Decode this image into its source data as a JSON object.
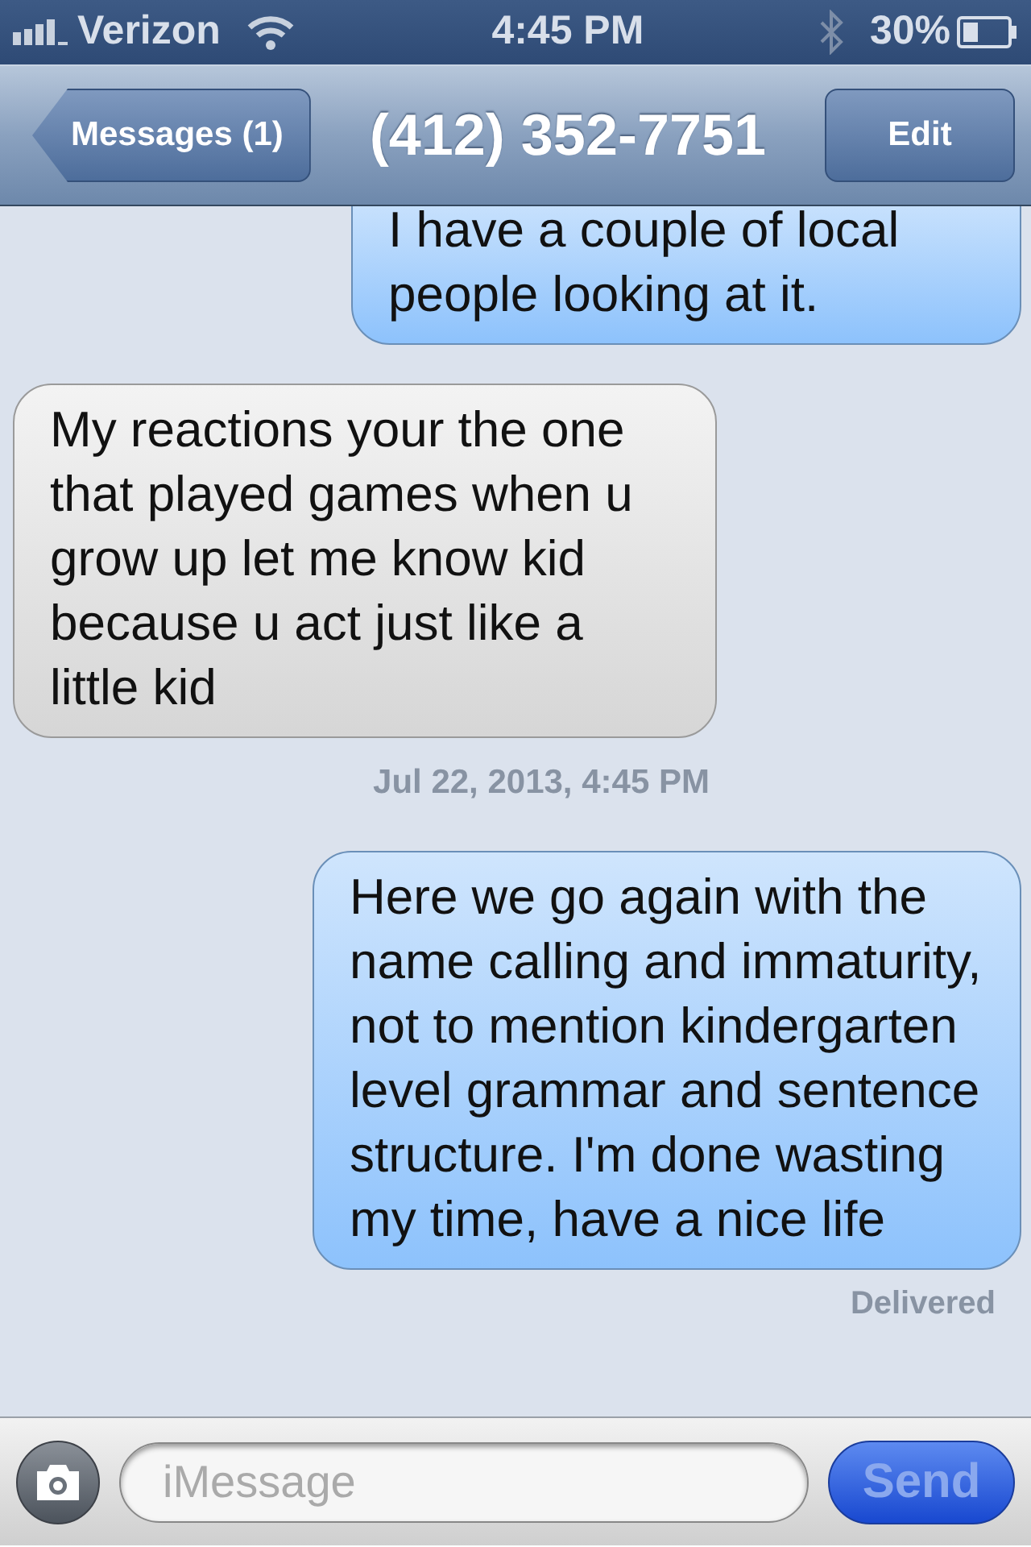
{
  "status_bar": {
    "carrier": "Verizon",
    "time": "4:45 PM",
    "battery": "30%",
    "bluetooth": true
  },
  "nav": {
    "back": "Messages (1)",
    "title": "(412) 352-7751",
    "edit": "Edit"
  },
  "messages": [
    {
      "kind": "sent",
      "text": "I have a couple of local people looking at it."
    },
    {
      "kind": "received",
      "text": "My reactions your the one that played games when u grow up let me know kid because u act just like a little kid"
    },
    {
      "kind": "timestamp",
      "text": "Jul 22, 2013, 4:45 PM"
    },
    {
      "kind": "sent",
      "text": "Here we go again with the name calling and immaturity, not to mention kindergarten level grammar and sentence structure. I'm done wasting my time, have a nice life"
    },
    {
      "kind": "status",
      "text": "Delivered"
    }
  ],
  "composer": {
    "placeholder": "iMessage",
    "send": "Send",
    "send_disabled": true
  }
}
